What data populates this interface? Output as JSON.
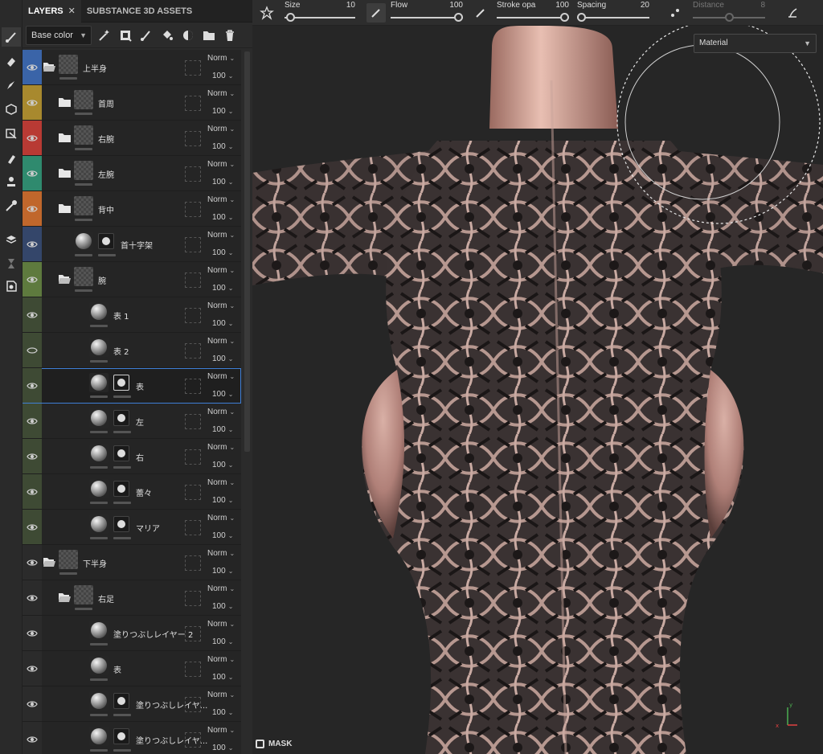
{
  "tabs": [
    {
      "label": "LAYERS",
      "active": true,
      "close": "✕"
    },
    {
      "label": "SUBSTANCE 3D ASSETS",
      "active": false
    }
  ],
  "channel_select": {
    "value": "Base color"
  },
  "top_bar": {
    "size": {
      "label": "Size",
      "value": "10",
      "fraction": 0.08
    },
    "flow": {
      "label": "Flow",
      "value": "100",
      "fraction": 1.0
    },
    "stroke_opacity": {
      "label": "Stroke opa",
      "value": "100",
      "fraction": 1.0
    },
    "spacing": {
      "label": "Spacing",
      "value": "20",
      "fraction": 0.06
    },
    "distance": {
      "label": "Distance",
      "value": "8",
      "fraction": 0.5,
      "disabled": true
    }
  },
  "material_select": {
    "value": "Material"
  },
  "mask_button": {
    "label": "MASK"
  },
  "layers": [
    {
      "name": "上半身",
      "type": "folder",
      "open": true,
      "color": "#3a64a8",
      "depth": 0,
      "blend": "Norm",
      "opacity": "100",
      "visible": true
    },
    {
      "name": "首周",
      "type": "folder",
      "open": false,
      "color": "#a8892e",
      "depth": 1,
      "blend": "Norm",
      "opacity": "100",
      "visible": true
    },
    {
      "name": "右腕",
      "type": "folder",
      "open": false,
      "color": "#b83a34",
      "depth": 1,
      "blend": "Norm",
      "opacity": "100",
      "visible": true
    },
    {
      "name": "左腕",
      "type": "folder",
      "open": false,
      "color": "#2f8a6e",
      "depth": 1,
      "blend": "Norm",
      "opacity": "100",
      "visible": true
    },
    {
      "name": "背中",
      "type": "folder",
      "open": false,
      "color": "#c0672c",
      "depth": 1,
      "blend": "Norm",
      "opacity": "100",
      "visible": true
    },
    {
      "name": "首十字架",
      "type": "fill",
      "mask": true,
      "color": "#34466a",
      "depth": 1,
      "blend": "Norm",
      "opacity": "100",
      "visible": true
    },
    {
      "name": "腕",
      "type": "folder",
      "open": true,
      "color": "#5e7a3e",
      "depth": 1,
      "blend": "Norm",
      "opacity": "100",
      "visible": true
    },
    {
      "name": "表 1",
      "type": "fill",
      "mask": false,
      "color": "#3e4a34",
      "depth": 2,
      "blend": "Norm",
      "opacity": "100",
      "visible": true
    },
    {
      "name": "表 2",
      "type": "fill",
      "mask": false,
      "color": "#3e4a34",
      "depth": 2,
      "blend": "Norm",
      "opacity": "100",
      "visible": false
    },
    {
      "name": "表",
      "type": "fill",
      "mask": true,
      "mask_active": true,
      "color": "#3e4a34",
      "depth": 2,
      "blend": "Norm",
      "opacity": "100",
      "visible": true,
      "selected": true
    },
    {
      "name": "左",
      "type": "fill",
      "mask": true,
      "color": "#3e4a34",
      "depth": 2,
      "blend": "Norm",
      "opacity": "100",
      "visible": true
    },
    {
      "name": "右",
      "type": "fill",
      "mask": true,
      "color": "#3e4a34",
      "depth": 2,
      "blend": "Norm",
      "opacity": "100",
      "visible": true
    },
    {
      "name": "蕾々",
      "type": "fill",
      "mask": true,
      "color": "#3e4a34",
      "depth": 2,
      "blend": "Norm",
      "opacity": "100",
      "visible": true
    },
    {
      "name": "マリア",
      "type": "fill",
      "mask": true,
      "color": "#3e4a34",
      "depth": 2,
      "blend": "Norm",
      "opacity": "100",
      "visible": true
    },
    {
      "name": "下半身",
      "type": "folder",
      "open": true,
      "color": "",
      "depth": 0,
      "blend": "Norm",
      "opacity": "100",
      "visible": true
    },
    {
      "name": "右足",
      "type": "folder",
      "open": true,
      "color": "",
      "depth": 1,
      "blend": "Norm",
      "opacity": "100",
      "visible": true
    },
    {
      "name": "塗りつぶしレイヤー 2",
      "type": "fill",
      "mask": false,
      "color": "",
      "depth": 2,
      "blend": "Norm",
      "opacity": "100",
      "visible": true
    },
    {
      "name": "表",
      "type": "fill",
      "mask": false,
      "color": "",
      "depth": 2,
      "blend": "Norm",
      "opacity": "100",
      "visible": true
    },
    {
      "name": "塗りつぶしレイヤ...",
      "type": "fill",
      "mask": true,
      "color": "",
      "depth": 2,
      "blend": "Norm",
      "opacity": "100",
      "visible": true
    },
    {
      "name": "塗りつぶしレイヤ...",
      "type": "fill",
      "mask": true,
      "color": "",
      "depth": 2,
      "blend": "Norm",
      "opacity": "100",
      "visible": true
    }
  ],
  "tools": [
    "paint-brush-icon",
    "eraser-icon",
    "projection-icon",
    "geometry-icon",
    "polygon-fill-icon",
    "smudge-icon",
    "clone-icon",
    "color-picker-icon",
    "bake-icon",
    "timer-icon",
    "scene-icon"
  ]
}
